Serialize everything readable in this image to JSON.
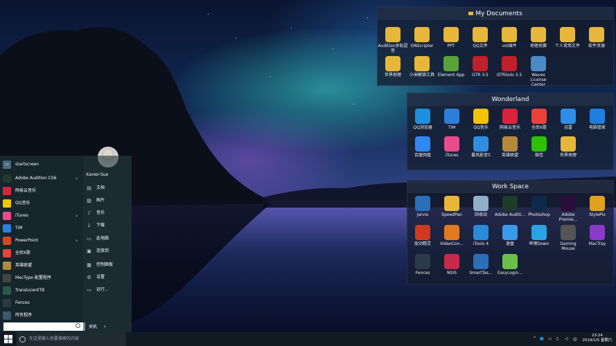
{
  "fences": {
    "my_documents": {
      "title": "My Documents",
      "icons": [
        {
          "label": "Audition多轨混音",
          "icon": "folder-icon",
          "color": "#e6b73b"
        },
        {
          "label": "ONScripter",
          "icon": "folder-icon",
          "color": "#e6b73b"
        },
        {
          "label": "PPT",
          "icon": "folder-icon",
          "color": "#e6b73b"
        },
        {
          "label": "QQ文件",
          "icon": "folder-icon",
          "color": "#e6b73b"
        },
        {
          "label": "vst插件",
          "icon": "folder-icon",
          "color": "#e6b73b"
        },
        {
          "label": "地理竞赛",
          "icon": "folder-icon",
          "color": "#e6b73b"
        },
        {
          "label": "个人常用文件",
          "icon": "folder-icon",
          "color": "#e6b73b"
        },
        {
          "label": "软件资源",
          "icon": "folder-icon",
          "color": "#e6b73b"
        },
        {
          "label": "世界地理",
          "icon": "folder-icon",
          "color": "#e6b73b"
        },
        {
          "label": "小米解锁工具",
          "icon": "folder-icon",
          "color": "#e6b73b"
        },
        {
          "label": "Element App",
          "icon": "element-icon",
          "color": "#5aa33a"
        },
        {
          "label": "GTR 3.5",
          "icon": "gtr-icon",
          "color": "#c0202a"
        },
        {
          "label": "GTRSolo 3.5",
          "icon": "gtrsolo-icon",
          "color": "#c0202a"
        },
        {
          "label": "Waves License Center",
          "icon": "waves-icon",
          "color": "#4a8ac8"
        }
      ]
    },
    "wonderland": {
      "title": "Wonderland",
      "icons": [
        {
          "label": "QQ浏览器",
          "icon": "qq-browser-icon",
          "color": "#1e8fe0"
        },
        {
          "label": "TIM",
          "icon": "tim-icon",
          "color": "#2c7ed8"
        },
        {
          "label": "QQ音乐",
          "icon": "qq-music-icon",
          "color": "#f2c300"
        },
        {
          "label": "网易云音乐",
          "icon": "netease-music-icon",
          "color": "#d7243a"
        },
        {
          "label": "全民K歌",
          "icon": "ksong-icon",
          "color": "#e8423a"
        },
        {
          "label": "迅雷",
          "icon": "xunlei-icon",
          "color": "#2d8de8"
        },
        {
          "label": "电脑管家",
          "icon": "pc-manager-icon",
          "color": "#1e7fe0"
        },
        {
          "label": "百度网盘",
          "icon": "baidu-netdisk-icon",
          "color": "#2f87f0"
        },
        {
          "label": "iTunes",
          "icon": "itunes-icon",
          "color": "#e84c8a"
        },
        {
          "label": "暴风影音5",
          "icon": "storm-player-icon",
          "color": "#2e8fe0"
        },
        {
          "label": "英雄联盟",
          "icon": "lol-icon",
          "color": "#b38a3a"
        },
        {
          "label": "微信",
          "icon": "wechat-icon",
          "color": "#2dc100"
        },
        {
          "label": "世界地理",
          "icon": "folder-icon",
          "color": "#e6b73b"
        }
      ]
    },
    "work_space": {
      "title": "Work Space",
      "icons": [
        {
          "label": "Jarvis",
          "icon": "jarvis-icon",
          "color": "#2a6fb8"
        },
        {
          "label": "SpeedPan",
          "icon": "speedpan-icon",
          "color": "#e6b73b"
        },
        {
          "label": "回收站",
          "icon": "recycle-bin-icon",
          "color": "#8fb0c8"
        },
        {
          "label": "Adobe Auditi...",
          "icon": "audition-icon",
          "color": "#1f3b2a"
        },
        {
          "label": "Photoshop",
          "icon": "photoshop-icon",
          "color": "#0e2a4a"
        },
        {
          "label": "Adobe Premie...",
          "icon": "premiere-icon",
          "color": "#2a0e3a"
        },
        {
          "label": "StylePix",
          "icon": "stylepix-icon",
          "color": "#e0a020"
        },
        {
          "label": "驱动精灵",
          "icon": "driver-genius-icon",
          "color": "#d23a20"
        },
        {
          "label": "VideoCon...",
          "icon": "videocon-icon",
          "color": "#e07a20"
        },
        {
          "label": "iTools 4",
          "icon": "itools-icon",
          "color": "#2a8ad8"
        },
        {
          "label": "速盘",
          "icon": "supan-icon",
          "color": "#3a9ae8"
        },
        {
          "label": "哔哩Down",
          "icon": "bilidown-icon",
          "color": "#2aa3e0"
        },
        {
          "label": "Gaming Mouse",
          "icon": "gaming-mouse-icon",
          "color": "#555"
        },
        {
          "label": "MacTray",
          "icon": "mactray-icon",
          "color": "#8a3ac8"
        },
        {
          "label": "Fences",
          "icon": "fences-icon",
          "color": "#2a3a4a"
        },
        {
          "label": "NSIS",
          "icon": "nsis-icon",
          "color": "#c82a4a"
        },
        {
          "label": "SmartTas...",
          "icon": "smarttaskbar-icon",
          "color": "#2a6fb8"
        },
        {
          "label": "EasyLogin...",
          "icon": "easylogin-icon",
          "color": "#6ac04a"
        }
      ]
    }
  },
  "start_menu": {
    "header": "startscreen",
    "apps": [
      {
        "label": "Adobe Audition CS6",
        "icon": "audition-icon",
        "color": "#1f3b2a",
        "has_arrow": true
      },
      {
        "label": "网易云音乐",
        "icon": "netease-music-icon",
        "color": "#d7243a",
        "has_arrow": false
      },
      {
        "label": "QQ音乐",
        "icon": "qq-music-icon",
        "color": "#f2c300",
        "has_arrow": false
      },
      {
        "label": "iTunes",
        "icon": "itunes-icon",
        "color": "#e84c8a",
        "has_arrow": true
      },
      {
        "label": "TIM",
        "icon": "tim-icon",
        "color": "#2c7ed8",
        "has_arrow": false
      },
      {
        "label": "PowerPoint",
        "icon": "powerpoint-icon",
        "color": "#d24726",
        "has_arrow": true
      },
      {
        "label": "全民K歌",
        "icon": "ksong-icon",
        "color": "#e8423a",
        "has_arrow": false
      },
      {
        "label": "英雄联盟",
        "icon": "lol-icon",
        "color": "#b38a3a",
        "has_arrow": false
      },
      {
        "label": "MacType 配置程序",
        "icon": "mactype-icon",
        "color": "#444",
        "has_arrow": false
      },
      {
        "label": "TranslucentTB",
        "icon": "translucenttb-icon",
        "color": "#2a5a4a",
        "has_arrow": false
      },
      {
        "label": "Fences",
        "icon": "fences-icon",
        "color": "#2a3a4a",
        "has_arrow": false
      },
      {
        "label": "所有程序",
        "icon": "all-programs-icon",
        "color": "#3a5a6a",
        "has_arrow": false
      }
    ],
    "user_name": "Xavier-Sue",
    "right_items": [
      {
        "label": "文档",
        "icon": "document-icon"
      },
      {
        "label": "图片",
        "icon": "picture-icon"
      },
      {
        "label": "音乐",
        "icon": "music-icon"
      },
      {
        "label": "下载",
        "icon": "download-icon"
      },
      {
        "label": "此电脑",
        "icon": "computer-icon"
      },
      {
        "label": "连接到",
        "icon": "connect-icon"
      },
      {
        "label": "控制面板",
        "icon": "control-panel-icon"
      },
      {
        "label": "设置",
        "icon": "settings-icon"
      },
      {
        "label": "运行...",
        "icon": "run-icon"
      }
    ],
    "search_value": "",
    "shutdown_label": "关机"
  },
  "taskbar": {
    "search_placeholder": "在这里输入你要搜索的内容",
    "time": "23:24",
    "date": "2019/1/5 星期六"
  }
}
